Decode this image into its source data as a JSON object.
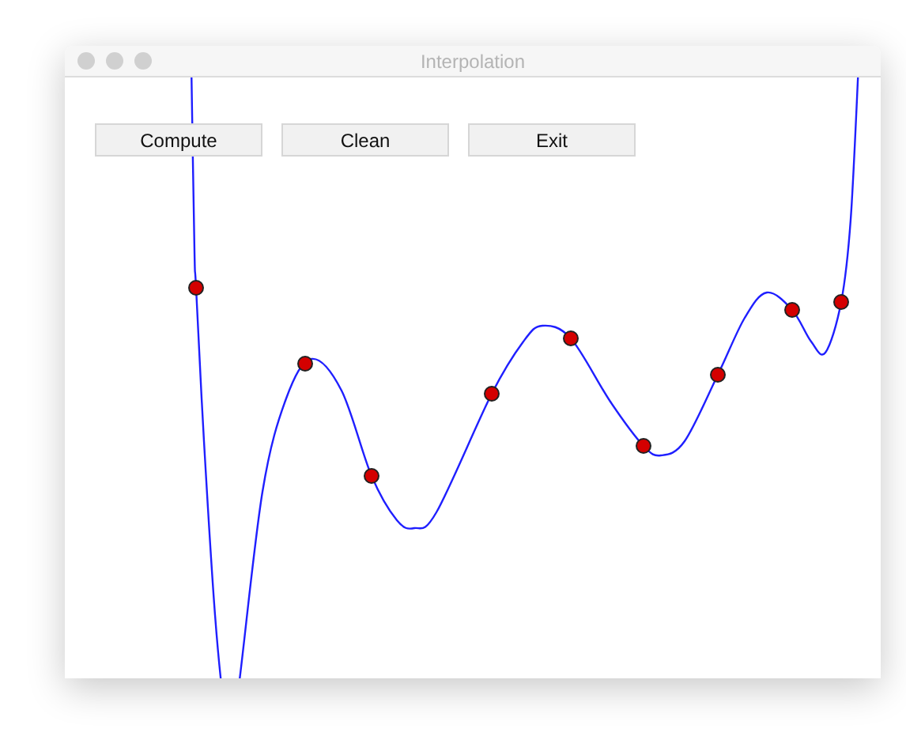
{
  "window": {
    "title": "Interpolation",
    "active": false
  },
  "buttons": [
    {
      "label": "Compute"
    },
    {
      "label": "Clean"
    },
    {
      "label": "Exit"
    }
  ]
}
